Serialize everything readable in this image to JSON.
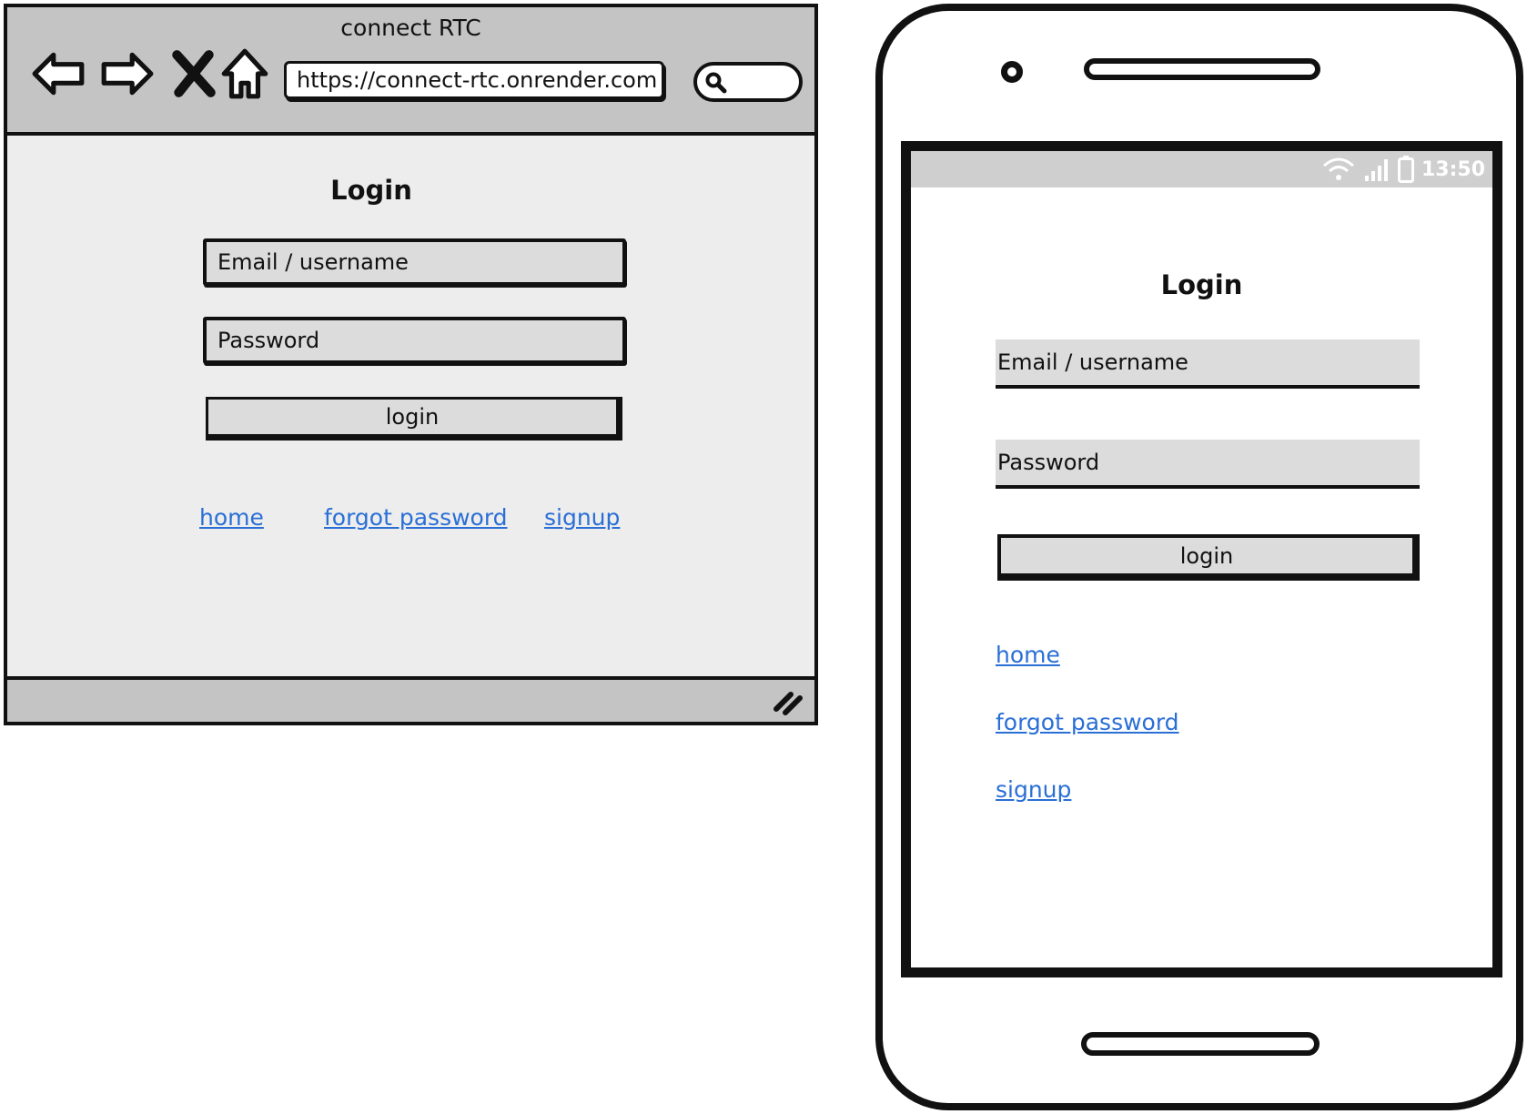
{
  "browser": {
    "title": "connect RTC",
    "url": "https://connect-rtc.onrender.com",
    "nav_icons": [
      "back-arrow-icon",
      "forward-arrow-icon",
      "stop-x-icon",
      "home-icon"
    ],
    "search_icon": "search-icon",
    "form": {
      "heading": "Login",
      "email_placeholder": "Email / username",
      "password_placeholder": "Password",
      "login_label": "login"
    },
    "links": [
      {
        "label": "home"
      },
      {
        "label": "forgot password"
      },
      {
        "label": "signup"
      }
    ]
  },
  "phone": {
    "status_bar": {
      "time": "13:50",
      "icons": [
        "wifi-icon",
        "signal-icon",
        "battery-icon"
      ]
    },
    "form": {
      "heading": "Login",
      "email_placeholder": "Email / username",
      "password_placeholder": "Password",
      "login_label": "login"
    },
    "links": [
      {
        "label": "home"
      },
      {
        "label": "forgot password"
      },
      {
        "label": "signup"
      }
    ]
  },
  "colors": {
    "link": "#2a6fd6",
    "chrome_gray": "#c4c4c4",
    "page_bg": "#ededed",
    "field_gray": "#dcdcdc",
    "status_bar": "#cfcfcf",
    "outline": "#111111"
  }
}
